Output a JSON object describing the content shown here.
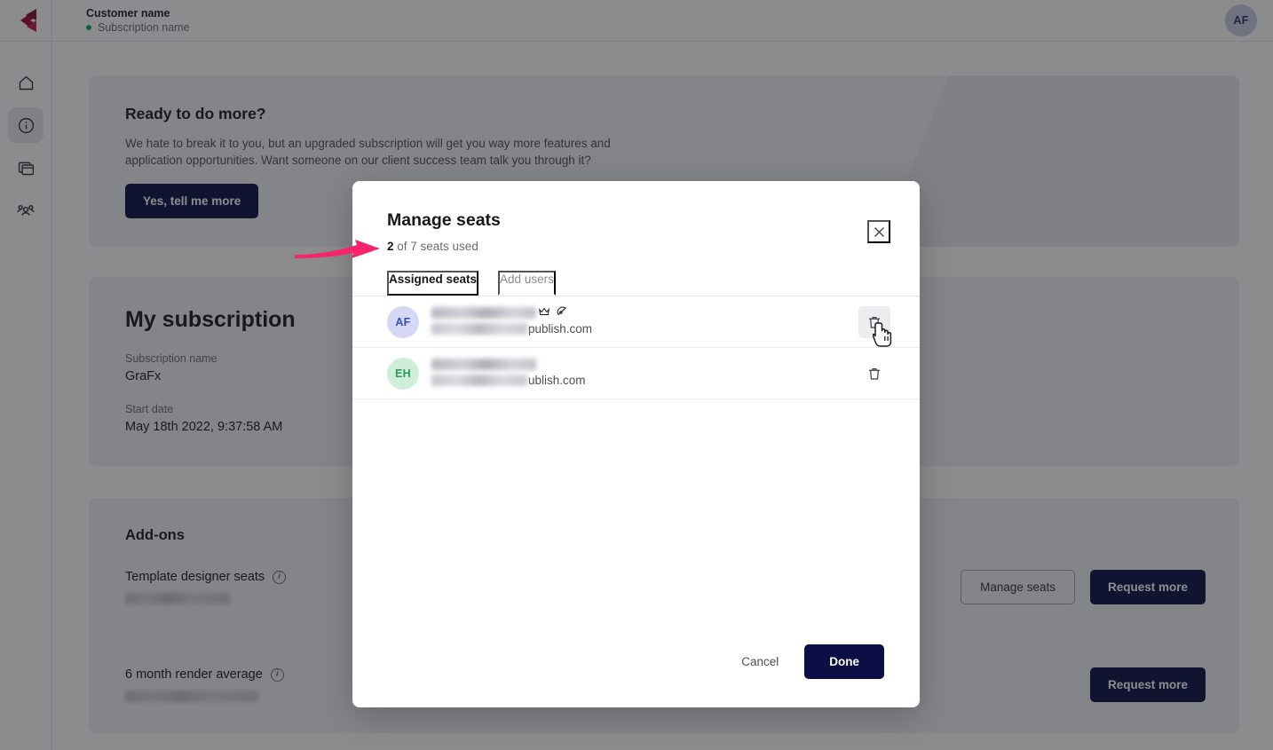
{
  "header": {
    "customer_name": "Customer name",
    "subscription_name": "Subscription name",
    "status_color": "#17a24a",
    "avatar_initials": "AF"
  },
  "sidebar": {
    "logo_name": "brand-logo",
    "items": [
      {
        "label": "Home",
        "icon": "home-icon",
        "active": false
      },
      {
        "label": "Subscription info",
        "icon": "info-circle-icon",
        "active": true
      },
      {
        "label": "Templates",
        "icon": "window-stack-icon",
        "active": false
      },
      {
        "label": "Users",
        "icon": "users-icon",
        "active": false
      }
    ]
  },
  "promo": {
    "title": "Ready to do more?",
    "body": "We hate to break it to you, but an upgraded subscription will get you way more features and application opportunities. Want someone on our client success team talk you through it?",
    "cta_label": "Yes, tell me more"
  },
  "subscription": {
    "title": "My subscription",
    "fields": [
      {
        "label": "Subscription name",
        "value": "GraFx"
      },
      {
        "label": "Start date",
        "value": "May 18th 2022, 9:37:58 AM"
      }
    ]
  },
  "addons": {
    "title": "Add-ons",
    "rows": [
      {
        "name": "Template designer seats",
        "info_icon": "info-icon",
        "value_redacted": true,
        "buttons": [
          {
            "label": "Manage seats",
            "style": "outline"
          },
          {
            "label": "Request more",
            "style": "primary"
          }
        ]
      },
      {
        "name": "6 month render average",
        "info_icon": "info-icon",
        "value_redacted": true,
        "buttons": [
          {
            "label": "Request more",
            "style": "primary"
          }
        ]
      }
    ]
  },
  "modal": {
    "title": "Manage seats",
    "seats_used_count": "2",
    "seats_used_suffix": " of 7 seats used",
    "close_icon": "close-icon",
    "tabs": [
      {
        "label": "Assigned seats",
        "active": true
      },
      {
        "label": "Add users",
        "active": false
      }
    ],
    "seats": [
      {
        "initials": "AF",
        "avatar_bg": "#d6d7f5",
        "avatar_fg": "#3f4bb8",
        "name_redacted": true,
        "badges": [
          "crown-icon",
          "pen-nib-icon"
        ],
        "email_domain": "publish.com",
        "delete_icon": "trash-icon",
        "hovered": true
      },
      {
        "initials": "EH",
        "avatar_bg": "#cfeed9",
        "avatar_fg": "#2f9a57",
        "name_redacted": true,
        "badges": [],
        "email_domain": "ublish.com",
        "delete_icon": "trash-icon",
        "hovered": false
      }
    ],
    "cancel_label": "Cancel",
    "done_label": "Done"
  },
  "annotation": {
    "arrow_color": "#f5246b",
    "points_at": "2 of 7 seats used"
  },
  "colors": {
    "primary_button": "#0b0f45",
    "page_card": "#f1f1f5",
    "overlay": "rgba(24,25,29,0.50)"
  }
}
